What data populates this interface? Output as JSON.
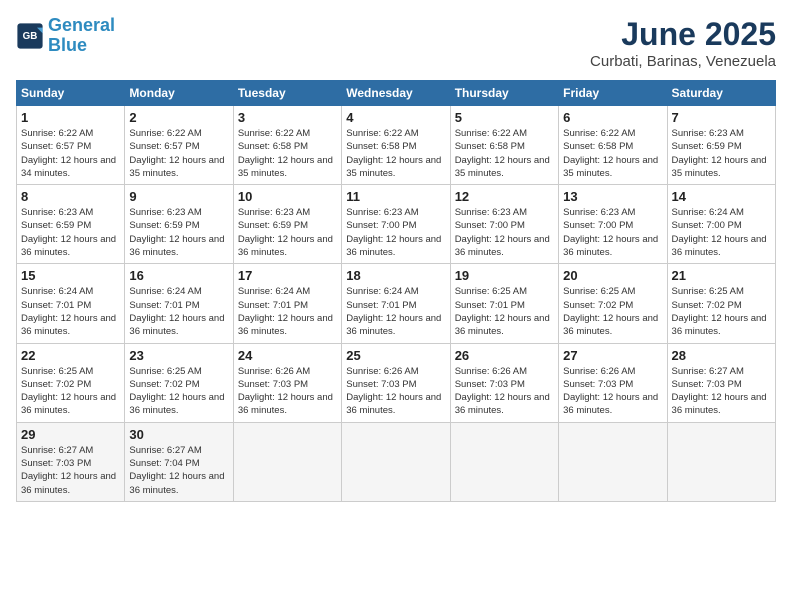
{
  "header": {
    "logo_line1": "General",
    "logo_line2": "Blue",
    "title": "June 2025",
    "subtitle": "Curbati, Barinas, Venezuela"
  },
  "weekdays": [
    "Sunday",
    "Monday",
    "Tuesday",
    "Wednesday",
    "Thursday",
    "Friday",
    "Saturday"
  ],
  "weeks": [
    [
      {
        "day": "1",
        "rise": "6:22 AM",
        "set": "6:57 PM",
        "daylight": "12 hours and 34 minutes."
      },
      {
        "day": "2",
        "rise": "6:22 AM",
        "set": "6:57 PM",
        "daylight": "12 hours and 35 minutes."
      },
      {
        "day": "3",
        "rise": "6:22 AM",
        "set": "6:58 PM",
        "daylight": "12 hours and 35 minutes."
      },
      {
        "day": "4",
        "rise": "6:22 AM",
        "set": "6:58 PM",
        "daylight": "12 hours and 35 minutes."
      },
      {
        "day": "5",
        "rise": "6:22 AM",
        "set": "6:58 PM",
        "daylight": "12 hours and 35 minutes."
      },
      {
        "day": "6",
        "rise": "6:22 AM",
        "set": "6:58 PM",
        "daylight": "12 hours and 35 minutes."
      },
      {
        "day": "7",
        "rise": "6:23 AM",
        "set": "6:59 PM",
        "daylight": "12 hours and 35 minutes."
      }
    ],
    [
      {
        "day": "8",
        "rise": "6:23 AM",
        "set": "6:59 PM",
        "daylight": "12 hours and 36 minutes."
      },
      {
        "day": "9",
        "rise": "6:23 AM",
        "set": "6:59 PM",
        "daylight": "12 hours and 36 minutes."
      },
      {
        "day": "10",
        "rise": "6:23 AM",
        "set": "6:59 PM",
        "daylight": "12 hours and 36 minutes."
      },
      {
        "day": "11",
        "rise": "6:23 AM",
        "set": "7:00 PM",
        "daylight": "12 hours and 36 minutes."
      },
      {
        "day": "12",
        "rise": "6:23 AM",
        "set": "7:00 PM",
        "daylight": "12 hours and 36 minutes."
      },
      {
        "day": "13",
        "rise": "6:23 AM",
        "set": "7:00 PM",
        "daylight": "12 hours and 36 minutes."
      },
      {
        "day": "14",
        "rise": "6:24 AM",
        "set": "7:00 PM",
        "daylight": "12 hours and 36 minutes."
      }
    ],
    [
      {
        "day": "15",
        "rise": "6:24 AM",
        "set": "7:01 PM",
        "daylight": "12 hours and 36 minutes."
      },
      {
        "day": "16",
        "rise": "6:24 AM",
        "set": "7:01 PM",
        "daylight": "12 hours and 36 minutes."
      },
      {
        "day": "17",
        "rise": "6:24 AM",
        "set": "7:01 PM",
        "daylight": "12 hours and 36 minutes."
      },
      {
        "day": "18",
        "rise": "6:24 AM",
        "set": "7:01 PM",
        "daylight": "12 hours and 36 minutes."
      },
      {
        "day": "19",
        "rise": "6:25 AM",
        "set": "7:01 PM",
        "daylight": "12 hours and 36 minutes."
      },
      {
        "day": "20",
        "rise": "6:25 AM",
        "set": "7:02 PM",
        "daylight": "12 hours and 36 minutes."
      },
      {
        "day": "21",
        "rise": "6:25 AM",
        "set": "7:02 PM",
        "daylight": "12 hours and 36 minutes."
      }
    ],
    [
      {
        "day": "22",
        "rise": "6:25 AM",
        "set": "7:02 PM",
        "daylight": "12 hours and 36 minutes."
      },
      {
        "day": "23",
        "rise": "6:25 AM",
        "set": "7:02 PM",
        "daylight": "12 hours and 36 minutes."
      },
      {
        "day": "24",
        "rise": "6:26 AM",
        "set": "7:03 PM",
        "daylight": "12 hours and 36 minutes."
      },
      {
        "day": "25",
        "rise": "6:26 AM",
        "set": "7:03 PM",
        "daylight": "12 hours and 36 minutes."
      },
      {
        "day": "26",
        "rise": "6:26 AM",
        "set": "7:03 PM",
        "daylight": "12 hours and 36 minutes."
      },
      {
        "day": "27",
        "rise": "6:26 AM",
        "set": "7:03 PM",
        "daylight": "12 hours and 36 minutes."
      },
      {
        "day": "28",
        "rise": "6:27 AM",
        "set": "7:03 PM",
        "daylight": "12 hours and 36 minutes."
      }
    ],
    [
      {
        "day": "29",
        "rise": "6:27 AM",
        "set": "7:03 PM",
        "daylight": "12 hours and 36 minutes."
      },
      {
        "day": "30",
        "rise": "6:27 AM",
        "set": "7:04 PM",
        "daylight": "12 hours and 36 minutes."
      },
      null,
      null,
      null,
      null,
      null
    ]
  ]
}
